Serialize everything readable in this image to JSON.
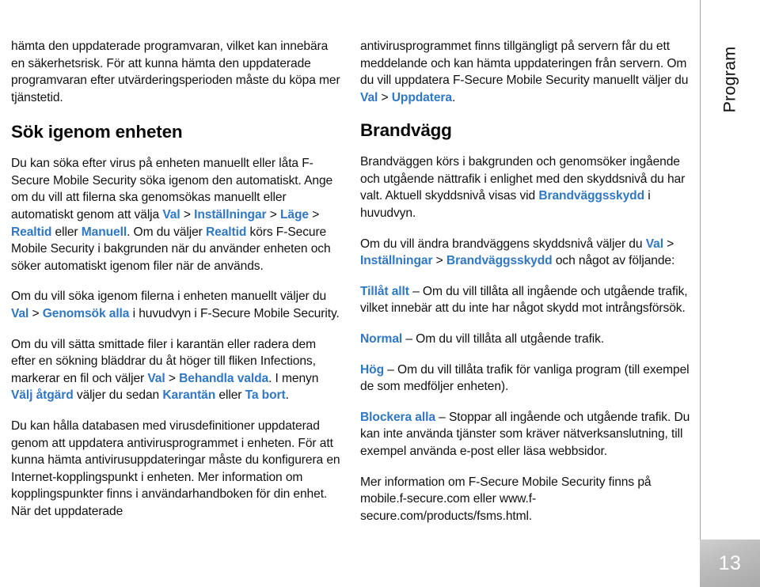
{
  "page": {
    "number": "13",
    "side_tab": "Program",
    "accent_color": "#3077c4",
    "background_color": "#ffffff",
    "tab_gradient_from": "#cfcfcf",
    "tab_gradient_to": "#a9a9a9"
  },
  "left_column": {
    "p1": {
      "t1": "hämta den uppdaterade programvaran, vilket kan innebära en säkerhetsrisk. För att kunna hämta den uppdaterade programvaran efter utvärderingsperioden måste du köpa mer tjänstetid."
    },
    "heading": "Sök igenom enheten",
    "p2": {
      "t1": "Du kan söka efter virus på enheten manuellt eller låta F-Secure Mobile Security söka igenom den automatiskt. Ange om du vill att filerna ska genomsökas manuellt eller automatiskt genom att välja ",
      "k1": "Val",
      "s1": " > ",
      "k2": "Inställningar",
      "s2": " > ",
      "k3": "Läge",
      "s3": " > ",
      "k4": "Realtid",
      "t2": " eller ",
      "k5": "Manuell",
      "t3": ". Om du väljer ",
      "k6": "Realtid",
      "t4": " körs F-Secure Mobile Security i bakgrunden när du använder enheten och söker automatiskt igenom filer när de används."
    },
    "p3": {
      "t1": "Om du vill söka igenom filerna i enheten manuellt väljer du ",
      "k1": "Val",
      "s1": " > ",
      "k2": "Genomsök alla",
      "t2": " i huvudvyn i F-Secure Mobile Security."
    },
    "p4": {
      "t1": "Om du vill sätta smittade filer i karantän eller radera dem efter en sökning bläddrar du åt höger till fliken Infections, markerar en fil och väljer ",
      "k1": "Val",
      "s1": " > ",
      "k2": "Behandla valda",
      "t2": ". I menyn ",
      "k3": "Välj åtgärd",
      "t3": " väljer du sedan ",
      "k4": "Karantän",
      "t4": " eller ",
      "k5": "Ta bort",
      "t5": "."
    },
    "p5": {
      "t1": "Du kan hålla databasen med virusdefinitioner uppdaterad genom att uppdatera antivirusprogrammet i enheten. För att kunna hämta antivirusuppdateringar måste du konfigurera en Internet-kopplingspunkt i enheten. Mer information om kopplingspunkter finns i användarhandboken för din enhet. När det uppdaterade"
    }
  },
  "right_column": {
    "p1": {
      "t1": "antivirusprogrammet finns tillgängligt på servern får du ett meddelande och kan hämta uppdateringen från servern. Om du vill uppdatera F-Secure Mobile Security manuellt väljer du ",
      "k1": "Val",
      "s1": " > ",
      "k2": "Uppdatera",
      "t2": "."
    },
    "heading": "Brandvägg",
    "p2": {
      "t1": "Brandväggen körs i bakgrunden och genomsöker ingående och utgående nättrafik i enlighet med den skyddsnivå du har valt. Aktuell skyddsnivå visas vid ",
      "k1": "Brandväggsskydd",
      "t2": " i huvudvyn."
    },
    "p3": {
      "t1": "Om du vill ändra brandväggens skyddsnivå väljer du ",
      "k1": "Val",
      "s1": " > ",
      "k2": "Inställningar",
      "s2": " > ",
      "k3": "Brandväggsskydd",
      "t2": " och något av följande:"
    },
    "p4": {
      "k1": "Tillåt allt",
      "t1": " – Om du vill tillåta all ingående och utgående trafik, vilket innebär att du inte har något skydd mot intrångsförsök."
    },
    "p5": {
      "k1": "Normal",
      "t1": " – Om du vill tillåta all utgående trafik."
    },
    "p6": {
      "k1": "Hög",
      "t1": " – Om du vill tillåta trafik för vanliga program (till exempel de som medföljer enheten)."
    },
    "p7": {
      "k1": "Blockera alla",
      "t1": " – Stoppar all ingående och utgående trafik. Du kan inte använda tjänster som kräver nätverksanslutning, till exempel använda e-post eller läsa webbsidor."
    },
    "p8": {
      "t1": "Mer information om F-Secure Mobile Security finns på mobile.f-secure.com eller www.f-secure.com/products/fsms.html."
    }
  }
}
